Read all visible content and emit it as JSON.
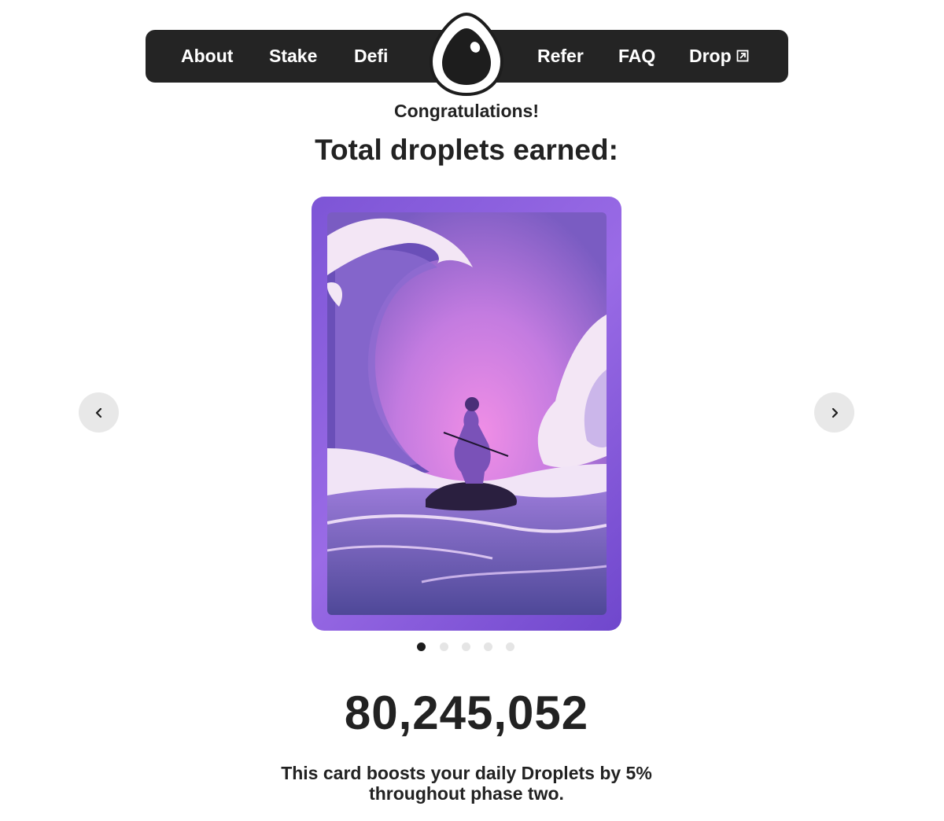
{
  "nav": {
    "about": "About",
    "stake": "Stake",
    "defi": "Defi",
    "refer": "Refer",
    "faq": "FAQ",
    "drop": "Drop"
  },
  "icons": {
    "logo": "droplet-logo-icon",
    "external": "external-link-icon",
    "prev": "chevron-left-icon",
    "next": "chevron-right-icon"
  },
  "main": {
    "congrats": "Congratulations!",
    "title": "Total droplets earned:",
    "total": "80,245,052",
    "boost_line1": "This card boosts your daily Droplets by 5%",
    "boost_line2": "throughout phase two."
  },
  "carousel": {
    "slide_count": 5,
    "active_index": 0
  },
  "colors": {
    "nav_bg": "#242424",
    "card_frame": "#8a5ddc",
    "text": "#222222",
    "dot_active": "#1d1d1d",
    "dot_inactive": "#e5e5e5",
    "arrow_bg": "#e8e8e8"
  }
}
